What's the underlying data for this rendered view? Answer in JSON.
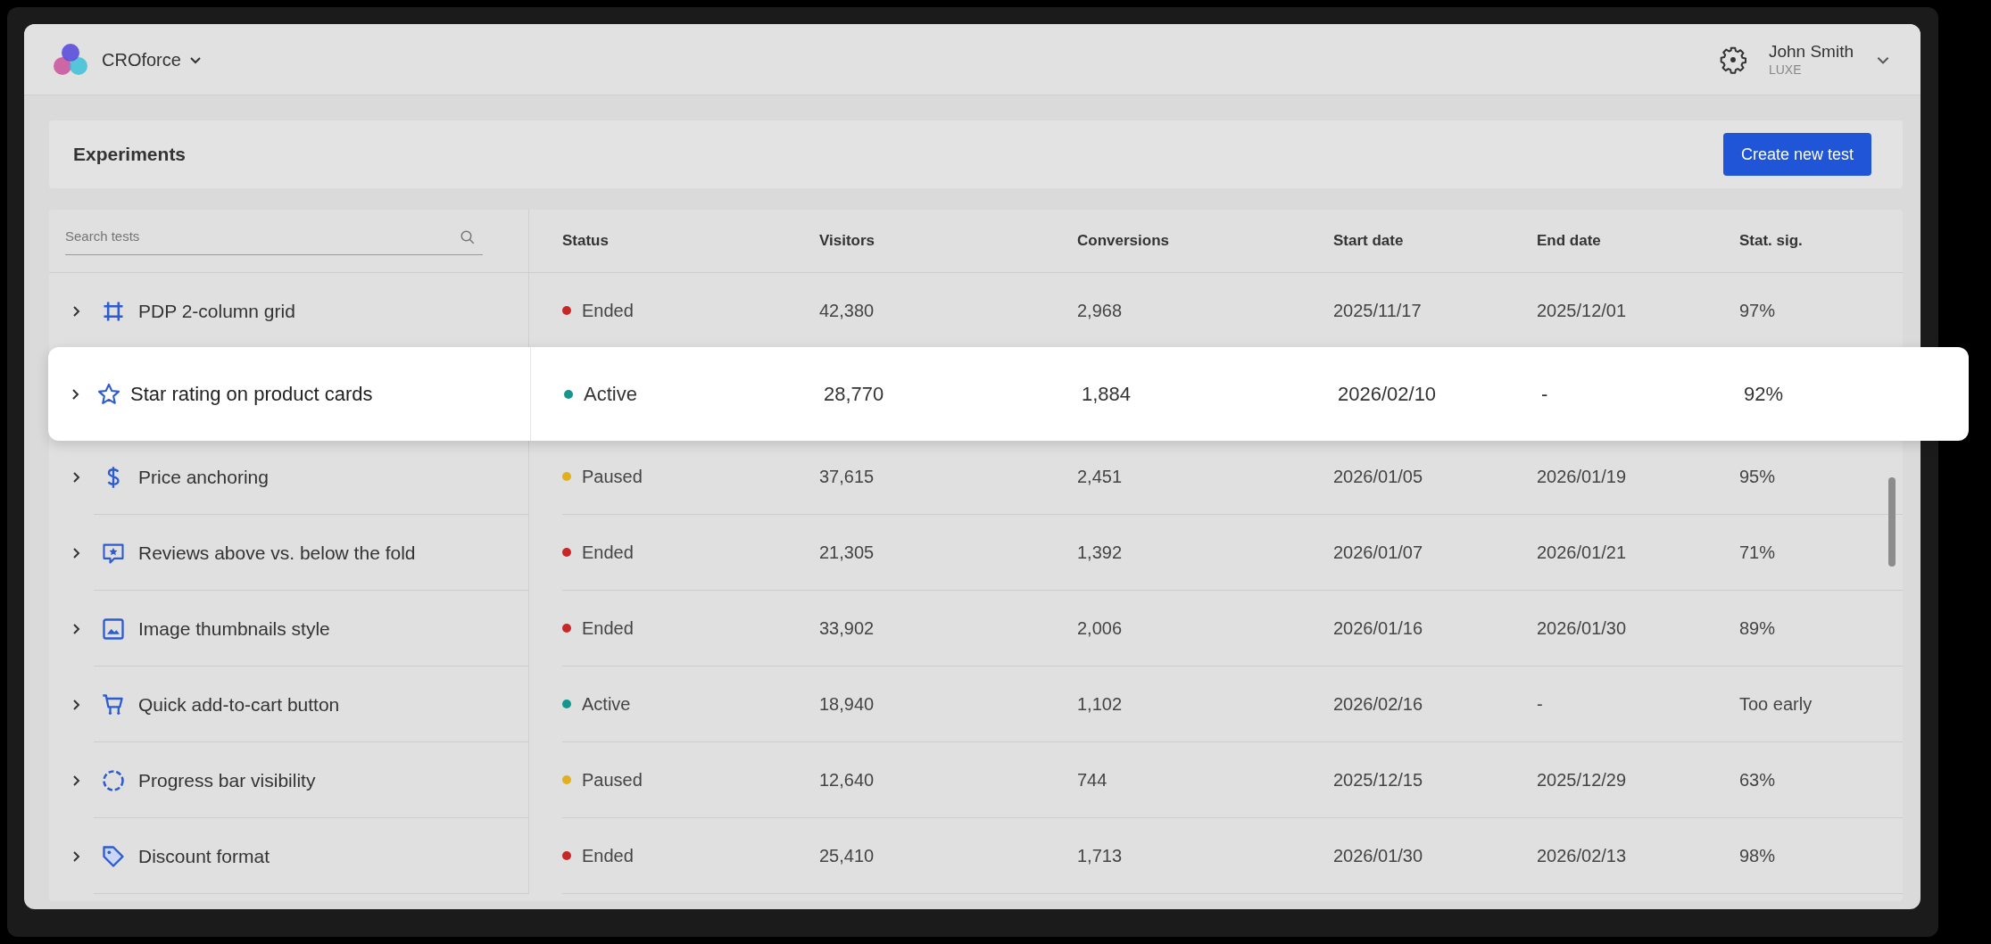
{
  "app": {
    "name": "CROforce",
    "user_name": "John Smith",
    "user_plan": "LUXE"
  },
  "page": {
    "title": "Experiments",
    "create_button": "Create new test"
  },
  "search": {
    "placeholder": "Search tests"
  },
  "columns": [
    "Status",
    "Visitors",
    "Conversions",
    "Start date",
    "End date",
    "Stat. sig."
  ],
  "rows": [
    {
      "kind": "crop",
      "name": "PDP 2-column grid",
      "status": "Ended",
      "color": "#c62828",
      "visitors": "42,380",
      "conversions": "2,968",
      "start_date": "2025/11/17",
      "end_date": "2025/12/01",
      "stat_sig": "97%",
      "highlighted": false
    },
    {
      "kind": "star",
      "name": "Star rating on product cards",
      "status": "Active",
      "color": "#14968f",
      "visitors": "28,770",
      "conversions": "1,884",
      "start_date": "2026/02/10",
      "end_date": "-",
      "stat_sig": "92%",
      "highlighted": true
    },
    {
      "kind": "dollar",
      "name": "Price anchoring",
      "status": "Paused",
      "color": "#e0b020",
      "visitors": "37,615",
      "conversions": "2,451",
      "start_date": "2026/01/05",
      "end_date": "2026/01/19",
      "stat_sig": "95%",
      "highlighted": false
    },
    {
      "kind": "review",
      "name": "Reviews above vs. below the fold",
      "status": "Ended",
      "color": "#c62828",
      "visitors": "21,305",
      "conversions": "1,392",
      "start_date": "2026/01/07",
      "end_date": "2026/01/21",
      "stat_sig": "71%",
      "highlighted": false
    },
    {
      "kind": "image",
      "name": "Image thumbnails style",
      "status": "Ended",
      "color": "#c62828",
      "visitors": "33,902",
      "conversions": "2,006",
      "start_date": "2026/01/16",
      "end_date": "2026/01/30",
      "stat_sig": "89%",
      "highlighted": false
    },
    {
      "kind": "cart",
      "name": "Quick add-to-cart button",
      "status": "Active",
      "color": "#14968f",
      "visitors": "18,940",
      "conversions": "1,102",
      "start_date": "2026/02/16",
      "end_date": "-",
      "stat_sig": "Too early",
      "highlighted": false
    },
    {
      "kind": "progress",
      "name": "Progress bar visibility",
      "status": "Paused",
      "color": "#e0b020",
      "visitors": "12,640",
      "conversions": "744",
      "start_date": "2025/12/15",
      "end_date": "2025/12/29",
      "stat_sig": "63%",
      "highlighted": false
    },
    {
      "kind": "tag",
      "name": "Discount format",
      "status": "Ended",
      "color": "#c62828",
      "visitors": "25,410",
      "conversions": "1,713",
      "start_date": "2026/01/30",
      "end_date": "2026/02/13",
      "stat_sig": "98%",
      "highlighted": false
    }
  ]
}
